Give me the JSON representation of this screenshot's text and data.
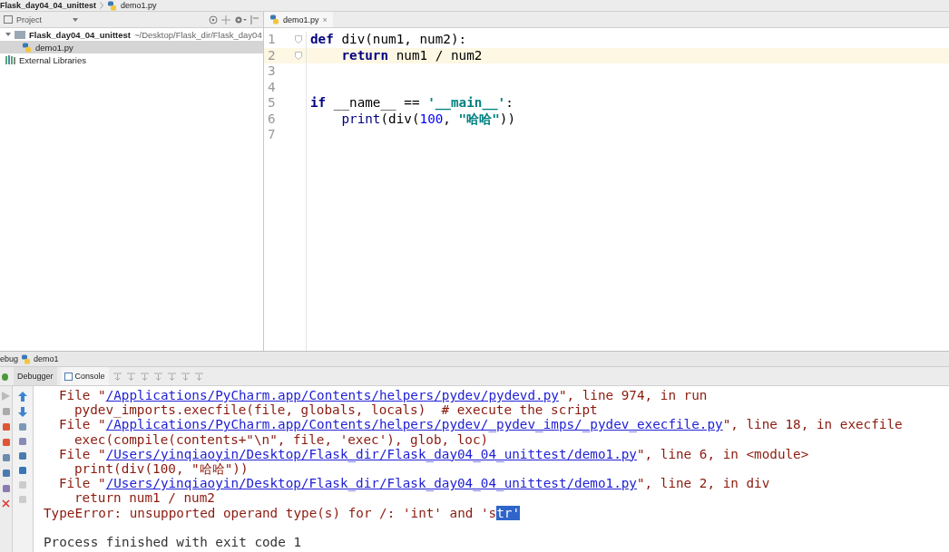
{
  "breadcrumbs": [
    "Flask_day04_04_unittest",
    "demo1.py"
  ],
  "project_panel": {
    "title": "Project",
    "tree": [
      {
        "label": "Flask_day04_04_unittest",
        "path": "~/Desktop/Flask_dir/Flask_day04",
        "kind": "folder",
        "selected": false,
        "children": [
          {
            "label": "demo1.py",
            "kind": "python",
            "selected": true
          }
        ]
      },
      {
        "label": "External Libraries",
        "kind": "library",
        "selected": false
      }
    ]
  },
  "editor": {
    "tabs": [
      {
        "label": "demo1.py",
        "close": "×",
        "selected": true
      }
    ],
    "lines": [
      {
        "number": "1",
        "current": false,
        "fold": true,
        "indented": false,
        "tokens": [
          {
            "kind": "keyword",
            "text": "def"
          },
          {
            "kind": "plain",
            "text": " div(num1, num2):"
          }
        ]
      },
      {
        "number": "2",
        "current": true,
        "fold": true,
        "indented": true,
        "tokens": [
          {
            "kind": "keyword",
            "text": "return"
          },
          {
            "kind": "plain",
            "text": " num1 / num2"
          }
        ]
      },
      {
        "number": "3",
        "current": false,
        "fold": false
      },
      {
        "number": "4",
        "current": false,
        "fold": false
      },
      {
        "number": "5",
        "current": false,
        "fold": false,
        "indented": false,
        "tokens": [
          {
            "kind": "keyword",
            "text": "if"
          },
          {
            "kind": "plain",
            "text": " __name__ == "
          },
          {
            "kind": "string",
            "text": "'__main__'"
          },
          {
            "kind": "plain",
            "text": ":"
          }
        ]
      },
      {
        "number": "6",
        "current": false,
        "fold": false,
        "indented": true,
        "tokens": [
          {
            "kind": "builtin",
            "text": "print"
          },
          {
            "kind": "plain",
            "text": "(div("
          },
          {
            "kind": "number",
            "text": "100"
          },
          {
            "kind": "plain",
            "text": ", "
          },
          {
            "kind": "string",
            "text": "\"哈哈\""
          },
          {
            "kind": "plain",
            "text": "))"
          }
        ]
      },
      {
        "number": "7",
        "current": false,
        "fold": false
      }
    ]
  },
  "debug": {
    "title": "ebug",
    "config": "demo1",
    "tabs": [
      {
        "label": "Debugger",
        "selected": false
      },
      {
        "label": "Console",
        "selected": true
      }
    ],
    "console": [
      {
        "kind": "frame",
        "parts": [
          {
            "kind": "text",
            "text": "File \""
          },
          {
            "kind": "link",
            "text": "/Applications/PyCharm.app/Contents/helpers/pydev/pydevd.py"
          },
          {
            "kind": "text",
            "text": "\", line 974, in run"
          }
        ]
      },
      {
        "kind": "source",
        "parts": [
          {
            "kind": "text",
            "text": "pydev_imports.execfile(file, globals, locals)  # execute the script"
          }
        ]
      },
      {
        "kind": "frame",
        "parts": [
          {
            "kind": "text",
            "text": "File \""
          },
          {
            "kind": "link",
            "text": "/Applications/PyCharm.app/Contents/helpers/pydev/_pydev_imps/_pydev_execfile.py"
          },
          {
            "kind": "text",
            "text": "\", line 18, in execfile"
          }
        ]
      },
      {
        "kind": "source",
        "parts": [
          {
            "kind": "text",
            "text": "exec(compile(contents+\"\\n\", file, 'exec'), glob, loc)"
          }
        ]
      },
      {
        "kind": "frame",
        "parts": [
          {
            "kind": "text",
            "text": "File \""
          },
          {
            "kind": "link",
            "text": "/Users/yinqiaoyin/Desktop/Flask_dir/Flask_day04_04_unittest/demo1.py"
          },
          {
            "kind": "text",
            "text": "\", line 6, in <module>"
          }
        ]
      },
      {
        "kind": "source",
        "parts": [
          {
            "kind": "text",
            "text": "print(div(100, \"哈哈\"))"
          }
        ]
      },
      {
        "kind": "frame",
        "parts": [
          {
            "kind": "text",
            "text": "File \""
          },
          {
            "kind": "link",
            "text": "/Users/yinqiaoyin/Desktop/Flask_dir/Flask_day04_04_unittest/demo1.py"
          },
          {
            "kind": "text",
            "text": "\", line 2, in div"
          }
        ]
      },
      {
        "kind": "source",
        "parts": [
          {
            "kind": "text",
            "text": "return num1 / num2"
          }
        ]
      },
      {
        "kind": "error",
        "parts": [
          {
            "kind": "text",
            "text": "TypeError: unsupported operand type(s) for /: 'int' and 's"
          },
          {
            "kind": "selection",
            "text": "tr'"
          }
        ]
      },
      {
        "kind": "blank"
      },
      {
        "kind": "info",
        "parts": [
          {
            "kind": "text",
            "text": "Process finished with exit code 1"
          }
        ]
      }
    ]
  }
}
